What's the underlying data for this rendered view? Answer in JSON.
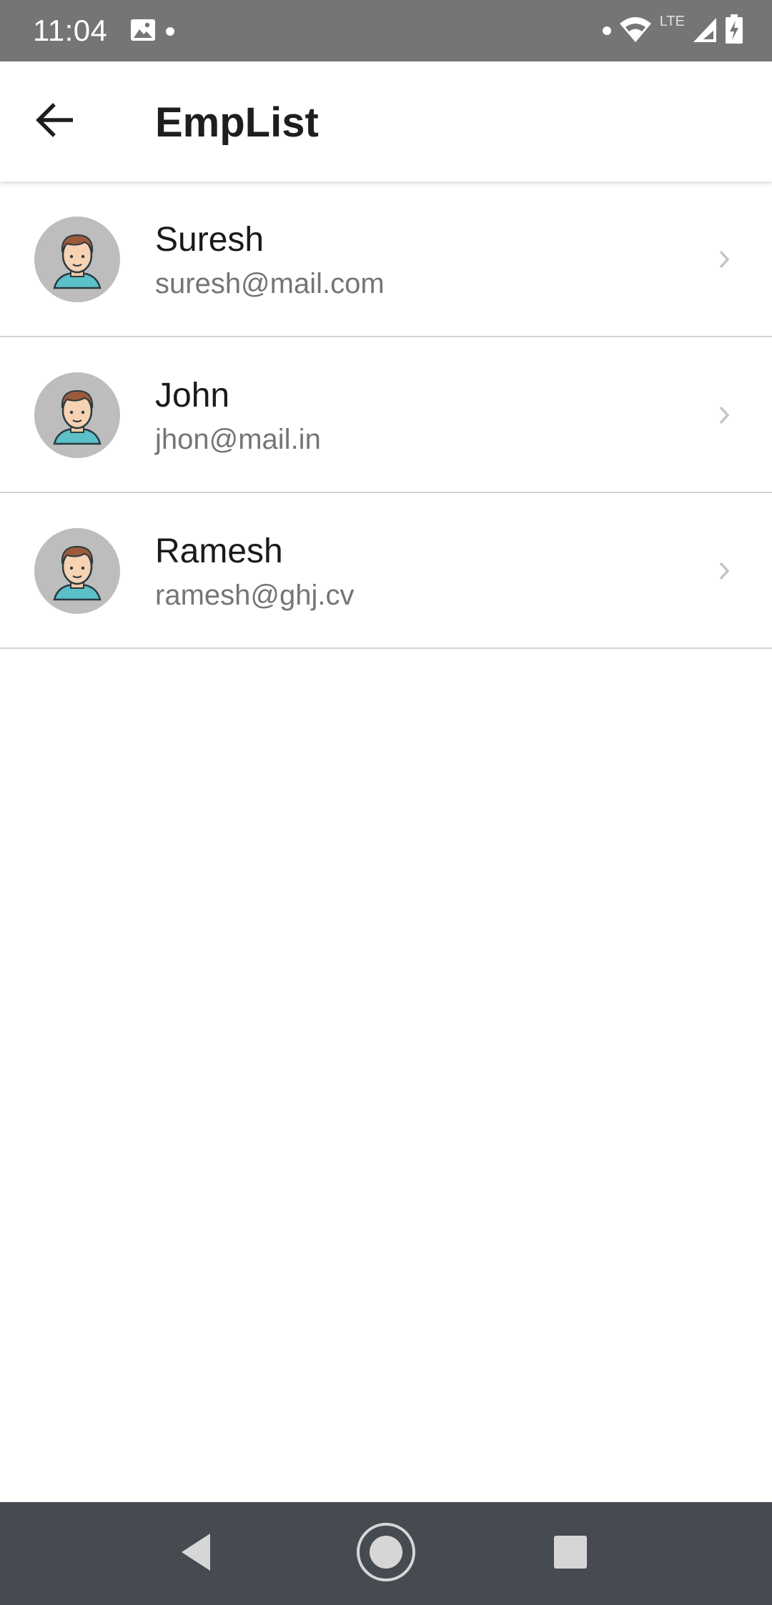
{
  "status_bar": {
    "time": "11:04",
    "network_label": "LTE",
    "icons": [
      "image-icon",
      "notification-dot-icon",
      "wifi-icon",
      "cell-signal-icon",
      "battery-charging-icon"
    ]
  },
  "app_bar": {
    "title": "EmpList",
    "back_icon": "arrow-back-icon"
  },
  "employees": [
    {
      "name": "Suresh",
      "email": "suresh@mail.com",
      "avatar_icon": "male-avatar-icon"
    },
    {
      "name": "John",
      "email": "jhon@mail.in",
      "avatar_icon": "male-avatar-icon"
    },
    {
      "name": "Ramesh",
      "email": "ramesh@ghj.cv",
      "avatar_icon": "male-avatar-icon"
    }
  ],
  "nav_bar": {
    "buttons": [
      "nav-back-icon",
      "nav-home-icon",
      "nav-recents-icon"
    ]
  },
  "colors": {
    "status_bar": "#757575",
    "nav_bar": "#454b51",
    "avatar_bg": "#bdbdbd",
    "divider": "#d4d4d4",
    "email_text": "#757575"
  }
}
